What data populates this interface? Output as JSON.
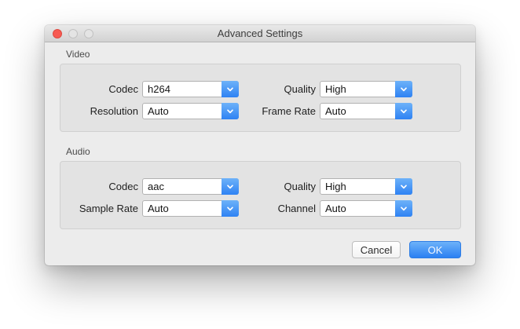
{
  "window": {
    "title": "Advanced Settings"
  },
  "sections": [
    {
      "label": "Video",
      "fields": [
        {
          "label": "Codec",
          "value": "h264"
        },
        {
          "label": "Quality",
          "value": "High"
        },
        {
          "label": "Resolution",
          "value": "Auto"
        },
        {
          "label": "Frame Rate",
          "value": "Auto"
        }
      ]
    },
    {
      "label": "Audio",
      "fields": [
        {
          "label": "Codec",
          "value": "aac"
        },
        {
          "label": "Quality",
          "value": "High"
        },
        {
          "label": "Sample Rate",
          "value": "Auto"
        },
        {
          "label": "Channel",
          "value": "Auto"
        }
      ]
    }
  ],
  "buttons": {
    "cancel": "Cancel",
    "ok": "OK"
  },
  "icons": {
    "dropdown": "chevron-down"
  },
  "colors": {
    "accent_blue": "#2e82f3",
    "accent_blue_light": "#6db2f9",
    "close_red": "#f75a52",
    "window_bg": "#ececec",
    "group_bg": "#e3e3e3"
  }
}
